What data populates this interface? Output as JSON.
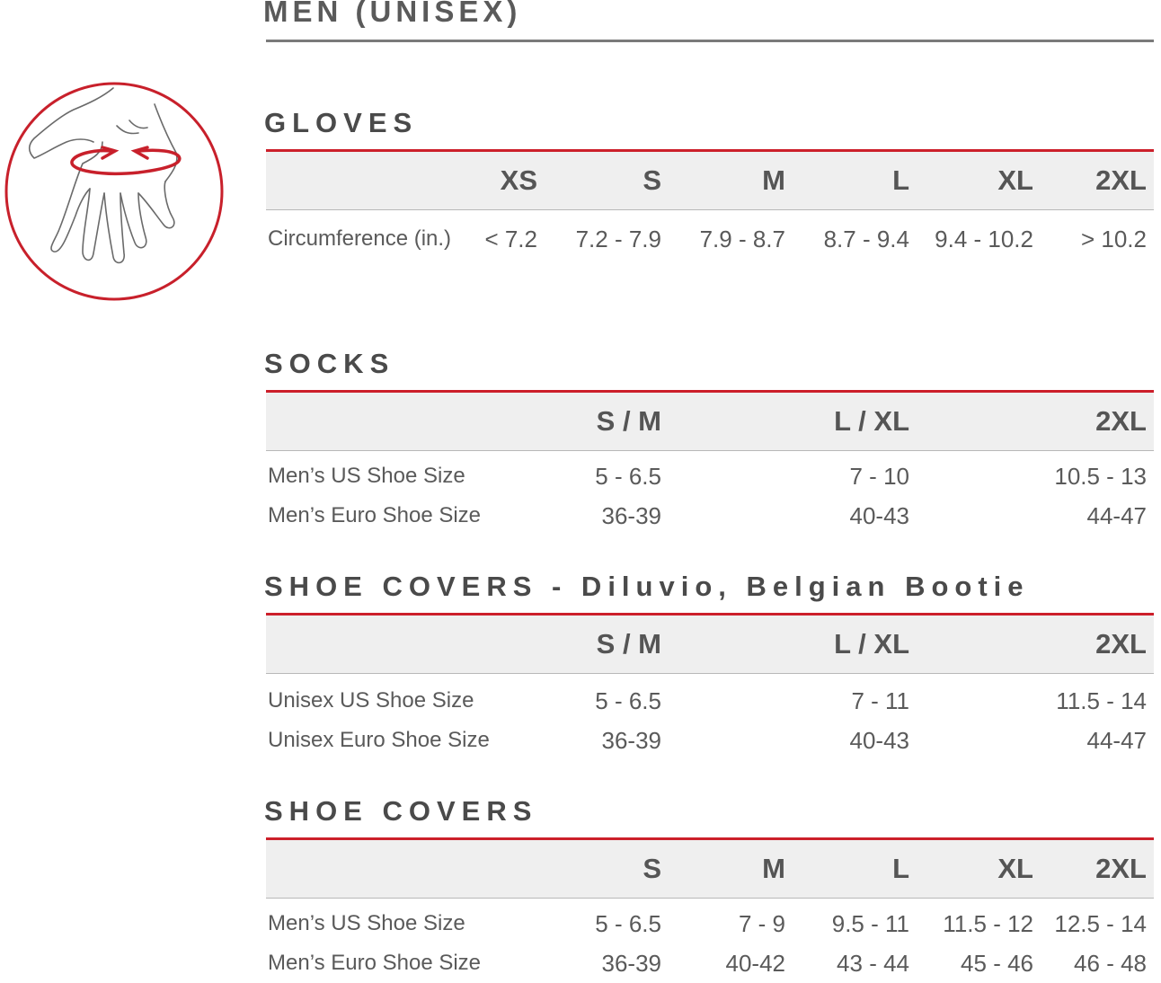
{
  "title": "MEN (UNISEX)",
  "icons": {
    "hand_measure": "hand-measurement-icon"
  },
  "colors": {
    "accent": "#cc1f2a",
    "text": "#5a5a5a",
    "header_bg": "#efefef"
  },
  "gloves": {
    "title": "GLOVES",
    "headers": [
      "XS",
      "S",
      "M",
      "L",
      "XL",
      "2XL"
    ],
    "rows": [
      {
        "label": "Circumference (in.)",
        "values": [
          "< 7.2",
          "7.2 - 7.9",
          "7.9 - 8.7",
          "8.7 - 9.4",
          "9.4 - 10.2",
          "> 10.2"
        ]
      }
    ]
  },
  "socks": {
    "title": "SOCKS",
    "headers": [
      "S / M",
      "L / XL",
      "2XL"
    ],
    "rows": [
      {
        "label": "Men’s US Shoe Size",
        "values": [
          "5 - 6.5",
          "7 - 10",
          "10.5 - 13"
        ]
      },
      {
        "label": "Men’s Euro Shoe Size",
        "values": [
          "36-39",
          "40-43",
          "44-47"
        ]
      }
    ]
  },
  "shoe_covers_diluvio": {
    "title": "SHOE COVERS - Diluvio, Belgian Bootie",
    "headers": [
      "S / M",
      "L / XL",
      "2XL"
    ],
    "rows": [
      {
        "label": "Unisex US Shoe Size",
        "values": [
          "5 - 6.5",
          "7 - 11",
          "11.5 - 14"
        ]
      },
      {
        "label": "Unisex Euro Shoe Size",
        "values": [
          "36-39",
          "40-43",
          "44-47"
        ]
      }
    ]
  },
  "shoe_covers": {
    "title": "SHOE COVERS",
    "headers": [
      "S",
      "M",
      "L",
      "XL",
      "2XL"
    ],
    "rows": [
      {
        "label": "Men’s US Shoe Size",
        "values": [
          "5 - 6.5",
          "7 - 9",
          "9.5 - 11",
          "11.5 - 12",
          "12.5 - 14"
        ]
      },
      {
        "label": "Men’s Euro Shoe Size",
        "values": [
          "36-39",
          "40-42",
          "43 - 44",
          "45 - 46",
          "46 - 48"
        ]
      }
    ]
  }
}
